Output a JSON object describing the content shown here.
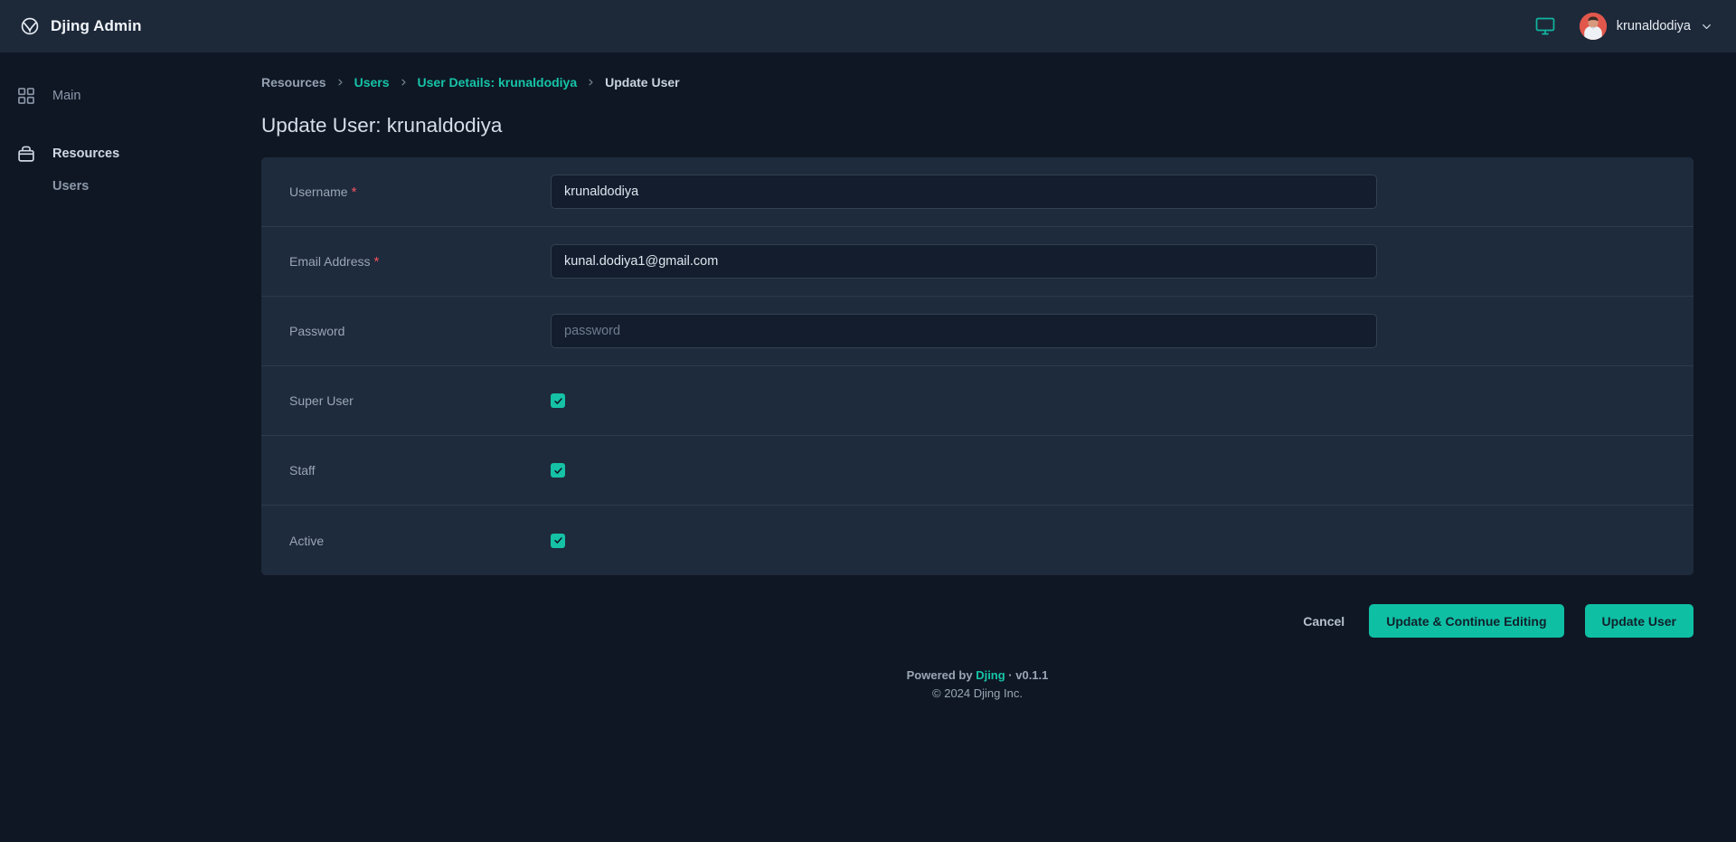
{
  "header": {
    "brand_title": "Djing Admin",
    "logo_icon": "globe-circle-icon",
    "monitor_icon": "desktop-monitor-icon",
    "user_name": "krunaldodiya",
    "chevron_icon": "chevron-down-icon"
  },
  "sidebar": {
    "items": [
      {
        "label": "Main",
        "icon": "grid-squares-icon"
      },
      {
        "label": "Resources",
        "icon": "archive-box-icon"
      }
    ],
    "sub_items": [
      {
        "label": "Users"
      }
    ]
  },
  "breadcrumb": [
    {
      "label": "Resources",
      "style": "muted"
    },
    {
      "label": "Users",
      "style": "link"
    },
    {
      "label": "User Details: krunaldodiya",
      "style": "link"
    },
    {
      "label": "Update User",
      "style": "current"
    }
  ],
  "page": {
    "title": "Update User: krunaldodiya"
  },
  "form": {
    "rows": [
      {
        "label": "Username",
        "required": true,
        "type": "text",
        "value": "krunaldodiya",
        "placeholder": ""
      },
      {
        "label": "Email Address",
        "required": true,
        "type": "text",
        "value": "kunal.dodiya1@gmail.com",
        "placeholder": ""
      },
      {
        "label": "Password",
        "required": false,
        "type": "password",
        "value": "",
        "placeholder": "password"
      },
      {
        "label": "Super User",
        "required": false,
        "type": "checkbox",
        "checked": true
      },
      {
        "label": "Staff",
        "required": false,
        "type": "checkbox",
        "checked": true
      },
      {
        "label": "Active",
        "required": false,
        "type": "checkbox",
        "checked": true
      }
    ]
  },
  "actions": {
    "cancel_label": "Cancel",
    "update_continue_label": "Update & Continue Editing",
    "update_label": "Update User"
  },
  "footer": {
    "powered_prefix": "Powered by ",
    "powered_brand": "Djing",
    "powered_suffix": " · v0.1.1",
    "copyright": "© 2024 Djing Inc."
  },
  "colors": {
    "accent": "#15c2a5",
    "accent_button": "#0fbfa4",
    "page_bg": "#0f1724",
    "panel_bg": "#1e2b3c",
    "topbar_bg": "#1d2939",
    "input_bg": "#131d2e",
    "required_red": "#f1515f",
    "muted_text": "#9aa6b5"
  }
}
